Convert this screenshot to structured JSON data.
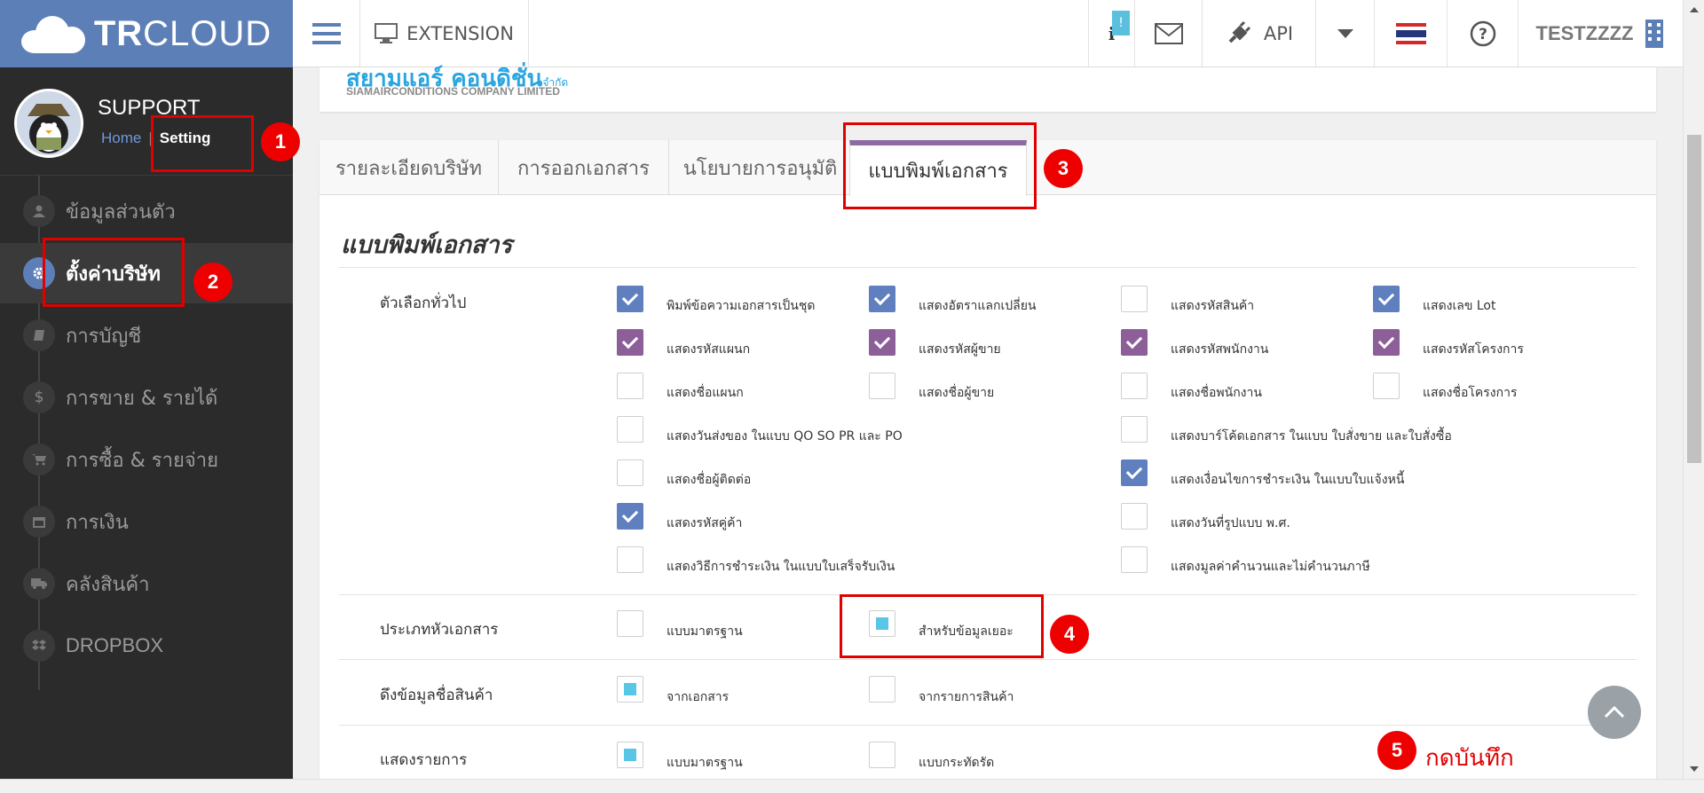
{
  "brand": {
    "bold": "TR",
    "rest": "CLOUD"
  },
  "topbar": {
    "extension_label": "EXTENSION",
    "api_label": "API",
    "user_label": "TESTZZZZ"
  },
  "profile": {
    "name": "SUPPORT",
    "home": "Home",
    "separator": "|",
    "setting": "Setting"
  },
  "sidebar": {
    "items": [
      {
        "label": "ข้อมูลส่วนตัว"
      },
      {
        "label": "ตั้งค่าบริษัท"
      },
      {
        "label": "การบัญชี"
      },
      {
        "label": "การขาย & รายได้"
      },
      {
        "label": "การซื้อ & รายจ่าย"
      },
      {
        "label": "การเงิน"
      },
      {
        "label": "คลังสินค้า"
      },
      {
        "label": "DROPBOX"
      }
    ]
  },
  "company": {
    "name_th": "สยามแอร์ คอนดิชั่น",
    "suffix_th": "จำกัด",
    "name_en": "SIAMAIRCONDITIONS COMPANY LIMITED"
  },
  "tabs": [
    "รายละเอียดบริษัท",
    "การออกเอกสาร",
    "นโยบายการอนุมัติ",
    "แบบพิมพ์เอกสาร"
  ],
  "section_title": "แบบพิมพ์เอกสาร",
  "general": {
    "label": "ตัวเลือกทั่วไป",
    "options": [
      "พิมพ์ข้อความเอกสารเป็นชุด",
      "แสดงอัตราแลกเปลี่ยน",
      "แสดงรหัสสินค้า",
      "แสดงเลข Lot",
      "แสดงรหัสแผนก",
      "แสดงรหัสผู้ขาย",
      "แสดงรหัสพนักงาน",
      "แสดงรหัสโครงการ",
      "แสดงชื่อแผนก",
      "แสดงชื่อผู้ขาย",
      "แสดงชื่อพนักงาน",
      "แสดงชื่อโครงการ",
      "แสดงวันส่งของ ในแบบ QO SO PR และ PO",
      "แสดงบาร์โค้ดเอกสาร ในแบบ ใบสั่งขาย และใบสั่งซื้อ",
      "แสดงชื่อผู้ติดต่อ",
      "แสดงเงื่อนไขการชำระเงิน ในแบบใบแจ้งหนี้",
      "แสดงรหัสคู่ค้า",
      "แสดงวันที่รูปแบบ พ.ศ.",
      "แสดงวิธีการชำระเงิน ในแบบใบเสร็จรับเงิน",
      "แสดงมูลค่าคำนวนและไม่คำนวนภาษี"
    ]
  },
  "header_type": {
    "label": "ประเภทหัวเอกสาร",
    "opt1": "แบบมาตรฐาน",
    "opt2": "สำหรับข้อมูลเยอะ"
  },
  "product_name": {
    "label": "ดึงข้อมูลชื่อสินค้า",
    "opt1": "จากเอกสาร",
    "opt2": "จากรายการสินค้า"
  },
  "display_items": {
    "label": "แสดงรายการ",
    "opt1": "แบบมาตรฐาน",
    "opt2": "แบบกระทัดรัด"
  },
  "annotations": {
    "b1": "1",
    "b2": "2",
    "b3": "3",
    "b4": "4",
    "b5": "5",
    "save_hint": "กดบันทึก"
  },
  "colors": {
    "brand_blue": "#5d7fb8",
    "check_blue": "#5f7fbf",
    "check_purple": "#8d5f99",
    "tab_accent": "#8e6aa3",
    "radio_fill": "#59c6e6",
    "annotation_red": "#e00000"
  }
}
